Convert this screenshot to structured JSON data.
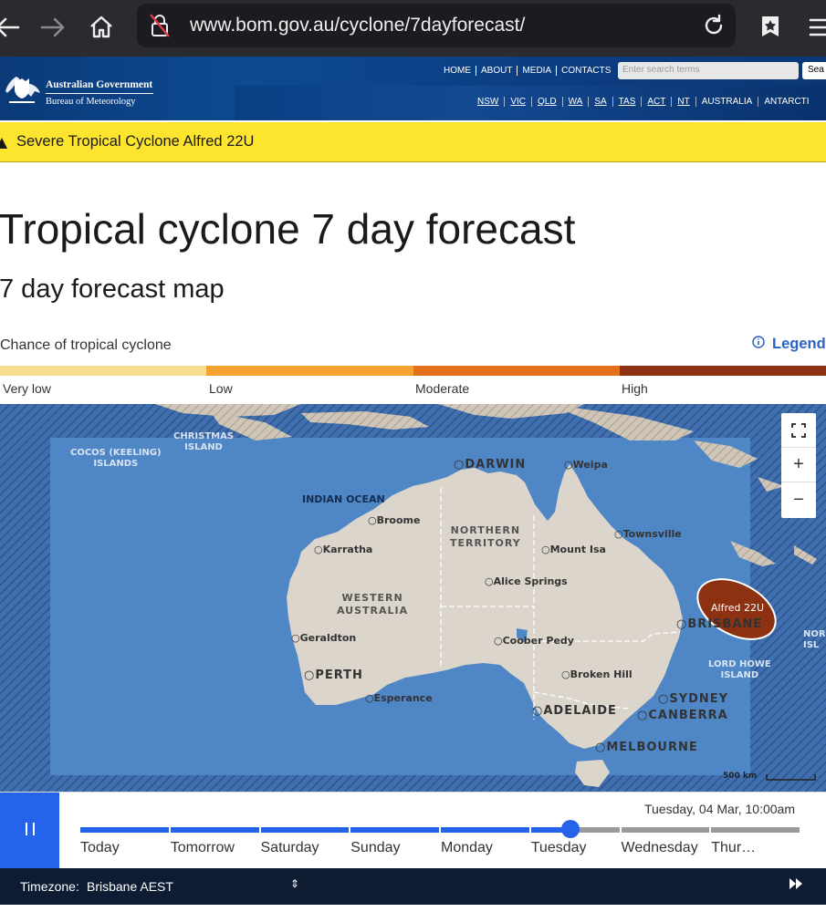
{
  "browser": {
    "url": "www.bom.gov.au/cyclone/7dayforecast/"
  },
  "header": {
    "gov_name": "Australian Government",
    "gov_sub": "Bureau of Meteorology",
    "top_links": [
      "HOME",
      "ABOUT",
      "MEDIA",
      "CONTACTS"
    ],
    "search_placeholder": "Enter search terms",
    "search_button": "Sea",
    "state_links": [
      "NSW",
      "VIC",
      "QLD",
      "WA",
      "SA",
      "TAS",
      "ACT",
      "NT",
      "AUSTRALIA",
      "ANTARCTI"
    ]
  },
  "alert": {
    "text": "Severe Tropical Cyclone Alfred 22U"
  },
  "page": {
    "title": "Tropical cyclone 7 day forecast",
    "subtitle": "7 day forecast map",
    "chance_label": "Chance of tropical cyclone",
    "legend_link": "Legend"
  },
  "scale": {
    "levels": [
      {
        "label": "Very low",
        "color": "#f9dd8e"
      },
      {
        "label": "Low",
        "color": "#f6a230"
      },
      {
        "label": "Moderate",
        "color": "#e2711a"
      },
      {
        "label": "High",
        "color": "#8c3112"
      }
    ]
  },
  "map": {
    "ocean_color": "#4f87c6",
    "land_color": "#dbd5cc",
    "cyclone_color": "#8c3112",
    "places": {
      "christmas": "CHRISTMAS\nISLAND",
      "cocos": "COCOS (KEELING)\nISLANDS",
      "darwin": "DARWIN",
      "weipa": "Weipa",
      "indian_ocean": "INDIAN OCEAN",
      "broome": "Broome",
      "nt": "NORTHERN\nTERRITORY",
      "townsville": "Townsville",
      "karratha": "Karratha",
      "mount_isa": "Mount Isa",
      "alice": "Alice Springs",
      "wa": "WESTERN\nAUSTRALIA",
      "alfred": "Alfred 22U",
      "brisbane": "BRISBANE",
      "nor": "NOR\nISL",
      "geraldton": "Geraldton",
      "coober": "Coober Pedy",
      "lord_howe": "LORD HOWE\nISLAND",
      "broken_hill": "Broken Hill",
      "perth": "PERTH",
      "sydney": "SYDNEY",
      "esperance": "Esperance",
      "adelaide": "ADELAIDE",
      "canberra": "CANBERRA",
      "melbourne": "MELBOURNE"
    },
    "scale_label": "500 km",
    "controls": [
      "fullscreen",
      "zoom-in",
      "zoom-out"
    ]
  },
  "timeline": {
    "timestamp": "Tuesday, 04 Mar, 10:00am",
    "days": [
      "Today",
      "Tomorrow",
      "Saturday",
      "Sunday",
      "Monday",
      "Tuesday",
      "Wednesday",
      "Thur…"
    ],
    "progress": 0.68,
    "active_color": "#2563eb",
    "inactive_color": "#9a9a9a"
  },
  "timezone": {
    "label": "Timezone:",
    "value": "Brisbane AEST"
  }
}
